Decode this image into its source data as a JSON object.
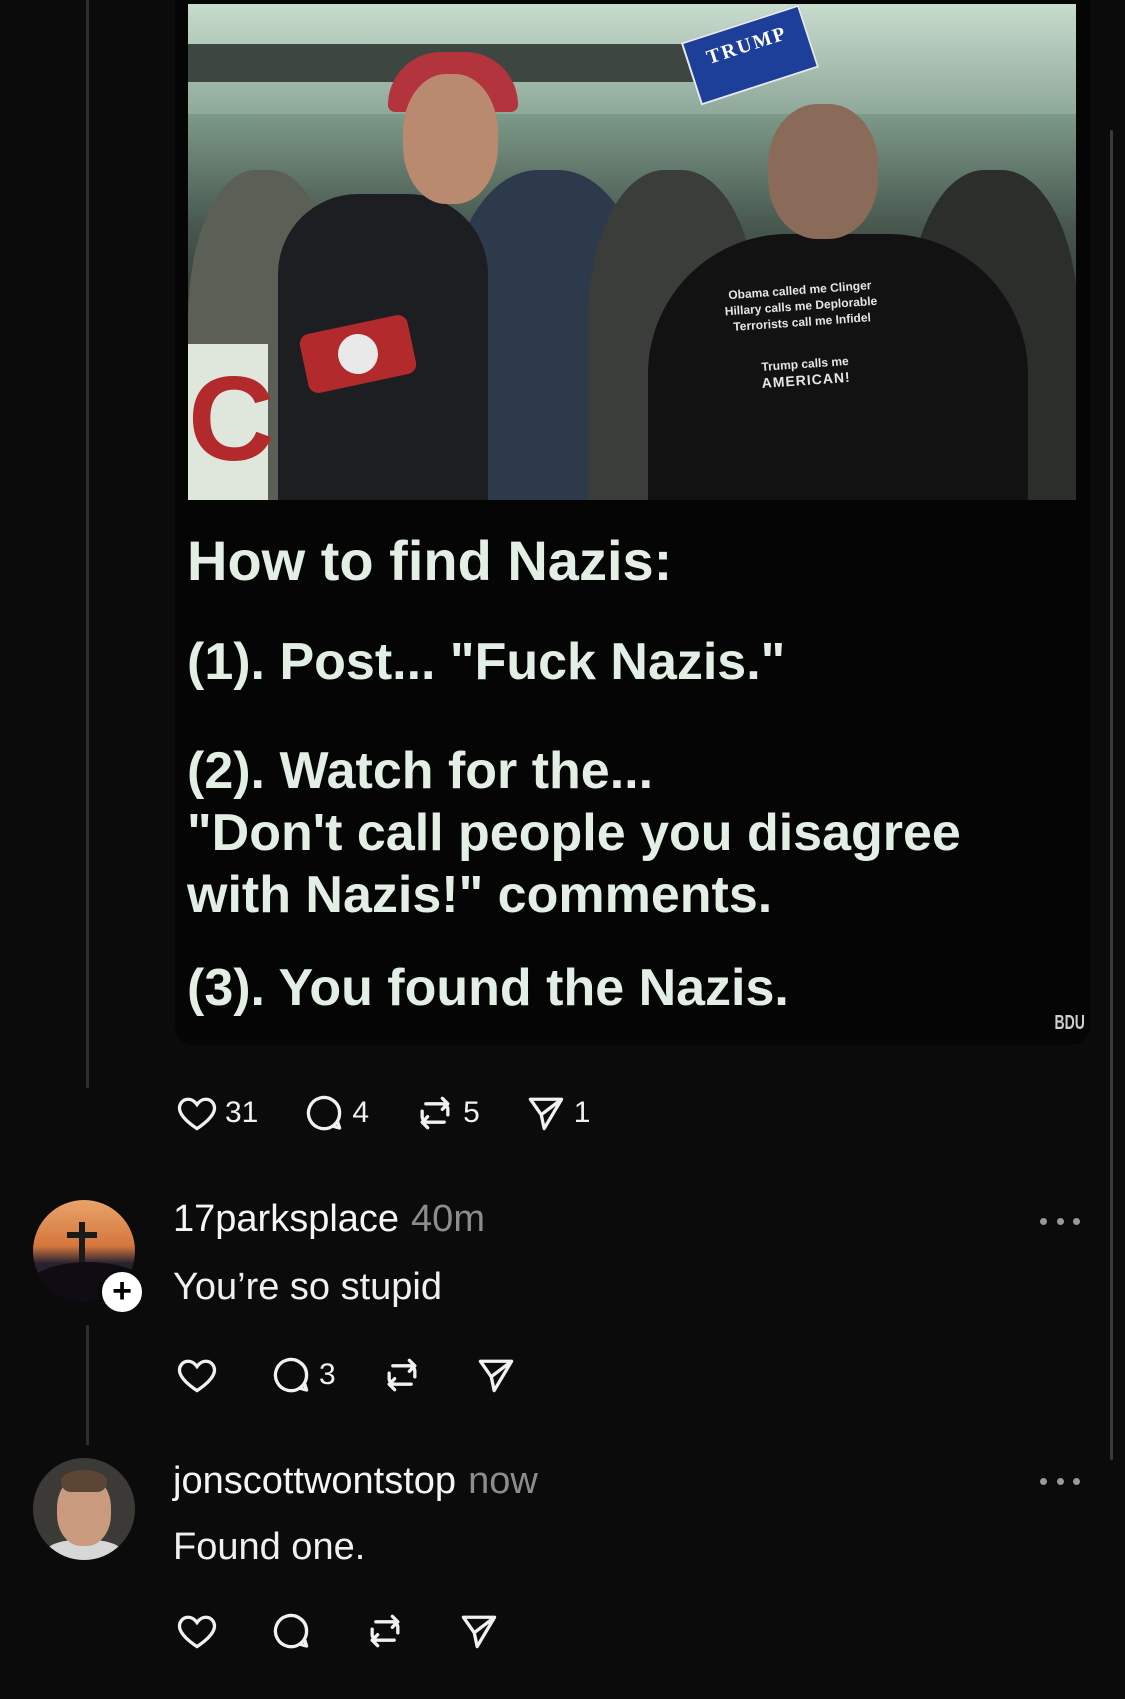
{
  "post": {
    "meme": {
      "sign_text": "TRUMP",
      "shirt_lines": [
        "Obama called me Clinger",
        "Hillary calls me Deplorable",
        "Terrorists call me Infidel",
        "Trump calls me",
        "AMERICAN!"
      ],
      "sign_letter": "C",
      "caption_title": "How to find Nazis:",
      "caption_1": "(1). Post... \"Fuck Nazis.\"",
      "caption_2a": "(2). Watch for the...",
      "caption_2b": "\"Don't call people you disagree",
      "caption_2c": "with Nazis!\" comments.",
      "caption_3": "(3). You found the Nazis.",
      "watermark": "BDU"
    },
    "actions": {
      "likes": "31",
      "replies": "4",
      "reposts": "5",
      "shares": "1"
    }
  },
  "replies": [
    {
      "username": "17parksplace",
      "time": "40m",
      "text": "You’re so stupid",
      "actions": {
        "likes": "",
        "replies": "3",
        "reposts": "",
        "shares": ""
      }
    },
    {
      "username": "jonscottwontstop",
      "time": "now",
      "text": "Found one.",
      "actions": {
        "likes": "",
        "replies": "",
        "reposts": "",
        "shares": ""
      }
    }
  ],
  "icons": {
    "like": "heart-icon",
    "reply": "comment-icon",
    "repost": "repost-icon",
    "share": "send-icon",
    "more": "more-icon",
    "follow": "plus-icon"
  },
  "colors": {
    "background": "#0b0b0b",
    "text": "#f1f1f1",
    "muted": "#8c8c8c",
    "caption": "#e3eee4"
  }
}
